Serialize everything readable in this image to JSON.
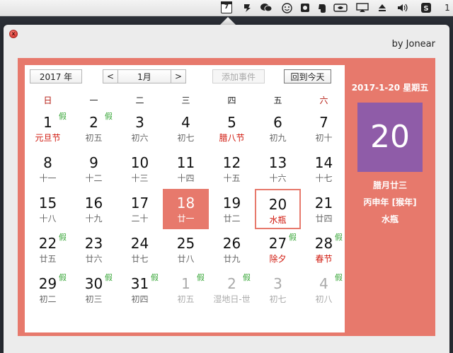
{
  "menubar": {
    "calendar_day": "7",
    "clock": "1"
  },
  "popover": {
    "author": "by Jonear",
    "close_glyph": "x"
  },
  "controls": {
    "year": "2017 年",
    "prev": "<",
    "month": "1月",
    "next": ">",
    "add_event": "添加事件",
    "back_today": "回到今天"
  },
  "weekdays": [
    "日",
    "一",
    "二",
    "三",
    "四",
    "五",
    "六"
  ],
  "calendar": {
    "rows": [
      [
        {
          "day": "1",
          "lunar": "元旦节",
          "fest": true,
          "tag": "假"
        },
        {
          "day": "2",
          "lunar": "初五",
          "tag": "假"
        },
        {
          "day": "3",
          "lunar": "初六"
        },
        {
          "day": "4",
          "lunar": "初七"
        },
        {
          "day": "5",
          "lunar": "腊八节",
          "fest": true
        },
        {
          "day": "6",
          "lunar": "初九"
        },
        {
          "day": "7",
          "lunar": "初十"
        }
      ],
      [
        {
          "day": "8",
          "lunar": "十一"
        },
        {
          "day": "9",
          "lunar": "十二"
        },
        {
          "day": "10",
          "lunar": "十三"
        },
        {
          "day": "11",
          "lunar": "十四"
        },
        {
          "day": "12",
          "lunar": "十五"
        },
        {
          "day": "13",
          "lunar": "十六"
        },
        {
          "day": "14",
          "lunar": "十七"
        }
      ],
      [
        {
          "day": "15",
          "lunar": "十八"
        },
        {
          "day": "16",
          "lunar": "十九"
        },
        {
          "day": "17",
          "lunar": "二十"
        },
        {
          "day": "18",
          "lunar": "廿一",
          "state": "sel"
        },
        {
          "day": "19",
          "lunar": "廿二"
        },
        {
          "day": "20",
          "lunar": "水瓶",
          "state": "today"
        },
        {
          "day": "21",
          "lunar": "廿四"
        }
      ],
      [
        {
          "day": "22",
          "lunar": "廿五",
          "tag": "假"
        },
        {
          "day": "23",
          "lunar": "廿六"
        },
        {
          "day": "24",
          "lunar": "廿七"
        },
        {
          "day": "25",
          "lunar": "廿八"
        },
        {
          "day": "26",
          "lunar": "廿九"
        },
        {
          "day": "27",
          "lunar": "除夕",
          "fest": true,
          "tag": "假"
        },
        {
          "day": "28",
          "lunar": "春节",
          "fest": true,
          "tag": "假"
        }
      ],
      [
        {
          "day": "29",
          "lunar": "初二",
          "tag": "假"
        },
        {
          "day": "30",
          "lunar": "初三",
          "tag": "假"
        },
        {
          "day": "31",
          "lunar": "初四",
          "tag": "假"
        },
        {
          "day": "1",
          "lunar": "初五",
          "tag": "假",
          "state": "dim"
        },
        {
          "day": "2",
          "lunar": "湿地日-世",
          "tag": "假",
          "state": "dim"
        },
        {
          "day": "3",
          "lunar": "初七",
          "state": "dim"
        },
        {
          "day": "4",
          "lunar": "初八",
          "tag": "假",
          "state": "dim"
        }
      ]
    ]
  },
  "side": {
    "date_title": "2017-1-20 星期五",
    "big_day": "20",
    "lunar_line": "腊月廿三",
    "ganzhi_line": "丙申年 [猴年]",
    "zodiac_line": "水瓶"
  },
  "colors": {
    "accent": "#e7796c",
    "day_box": "#8f5ca8",
    "holiday_tag": "#3aa73a",
    "festival": "#d0180d"
  }
}
